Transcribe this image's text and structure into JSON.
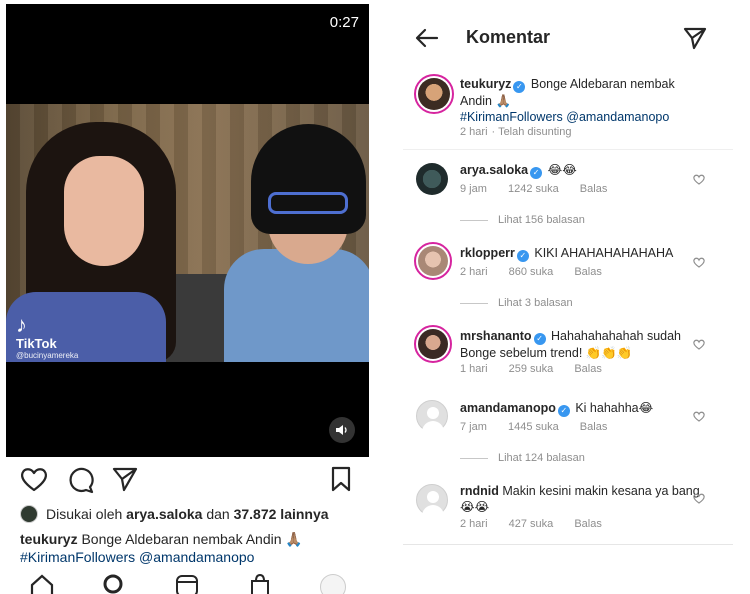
{
  "video": {
    "time": "0:27",
    "watermark_brand": "TikTok",
    "watermark_handle": "@bucinyamereka"
  },
  "post": {
    "liked_by_prefix": "Disukai oleh",
    "liked_by_user": "arya.saloka",
    "liked_by_connector": "dan",
    "liked_by_count": "37.872 lainnya",
    "caption_user": "teukuryz",
    "caption_text": "Bonge Aldebaran nembak Andin 🙏🏽",
    "caption_tags": "#KirimanFollowers @amandamanopo"
  },
  "comments_header": {
    "title": "Komentar"
  },
  "caption_comment": {
    "username": "teukuryz",
    "text": "Bonge Aldebaran nembak Andin 🙏🏽",
    "tags": "#KirimanFollowers @amandamanopo",
    "time": "2 hari",
    "status": "Telah disunting"
  },
  "comments": [
    {
      "username": "arya.saloka",
      "text": "😂😂",
      "time": "9 jam",
      "likes": "1242 suka",
      "reply": "Balas",
      "view_replies": "Lihat 156 balasan"
    },
    {
      "username": "rklopperr",
      "text": "KIKI AHAHAHAHAHAHA",
      "time": "2 hari",
      "likes": "860 suka",
      "reply": "Balas",
      "view_replies": "Lihat 3 balasan"
    },
    {
      "username": "mrshananto",
      "text": "Hahahahahahah sudah Bonge sebelum trend! 👏👏👏",
      "time": "1 hari",
      "likes": "259 suka",
      "reply": "Balas"
    },
    {
      "username": "amandamanopo",
      "text": "Ki hahahha😂",
      "time": "7 jam",
      "likes": "1445 suka",
      "reply": "Balas",
      "view_replies": "Lihat 124 balasan"
    },
    {
      "username": "rndnid",
      "text": "Makin kesini makin kesana ya bang😭😭",
      "time": "2 hari",
      "likes": "427 suka",
      "reply": "Balas"
    }
  ],
  "colors": {
    "verified": "#3897f0",
    "hashtag": "#00376b",
    "story_ring": "#d6249f",
    "meta": "#8e8e8e"
  }
}
